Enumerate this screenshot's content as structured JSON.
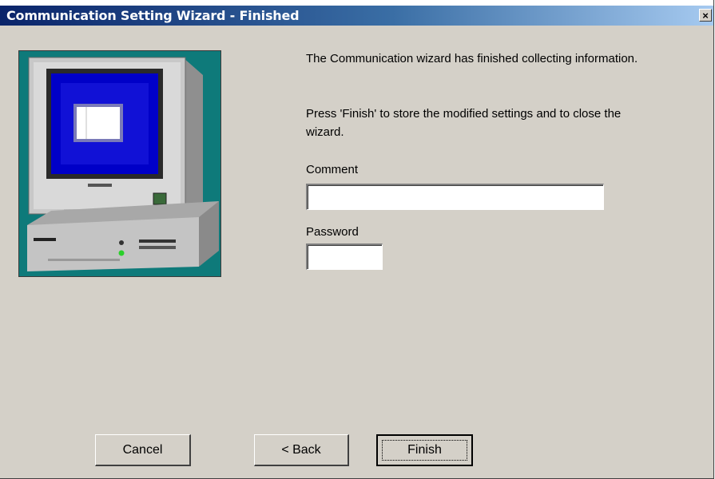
{
  "window": {
    "title": "Communication Setting Wizard - Finished",
    "close_glyph": "×"
  },
  "content": {
    "message1": "The Communication wizard has finished collecting information.",
    "message2": "Press 'Finish' to store the modified settings and to close the wizard.",
    "comment_label": "Comment",
    "comment_value": "",
    "password_label": "Password",
    "password_value": ""
  },
  "buttons": {
    "cancel": "Cancel",
    "back": "< Back",
    "finish": "Finish"
  },
  "illustration": {
    "icon": "computer-illustration",
    "background_color": "#0e7a7a",
    "screen_color": "#0000c8"
  }
}
